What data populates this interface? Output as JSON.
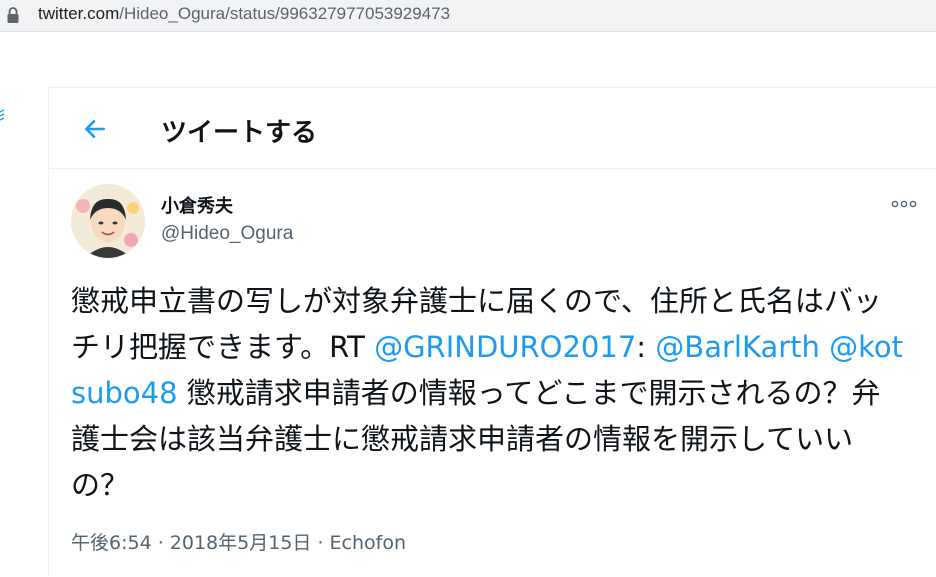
{
  "browser": {
    "url_domain": "twitter.com",
    "url_path": "/Hideo_Ogura/status/996327977053929473"
  },
  "header": {
    "title": "ツイートする",
    "back_icon": "arrow-left-icon"
  },
  "tweet": {
    "display_name": "小倉秀夫",
    "handle": "@Hideo_Ogura",
    "text_before": "懲戒申立書の写しが対象弁護士に届くので、住所と氏名はバッチリ把握できます。RT ",
    "mention_1": "@GRINDURO2017",
    "text_colon": ": ",
    "mention_2": "@BarlKarth",
    "text_space": " ",
    "mention_3": "@kotsubo48",
    "text_after": " 懲戒請求申請者の情報ってどこまで開示されるの？弁護士会は該当弁護士に懲戒請求申請者の情報を開示していいの？",
    "timestamp": "午後6:54 · 2018年5月15日",
    "separator": " · ",
    "source": "Echofon"
  },
  "colors": {
    "accent": "#1d9bf0",
    "text": "#0f1419",
    "secondary": "#536471"
  }
}
